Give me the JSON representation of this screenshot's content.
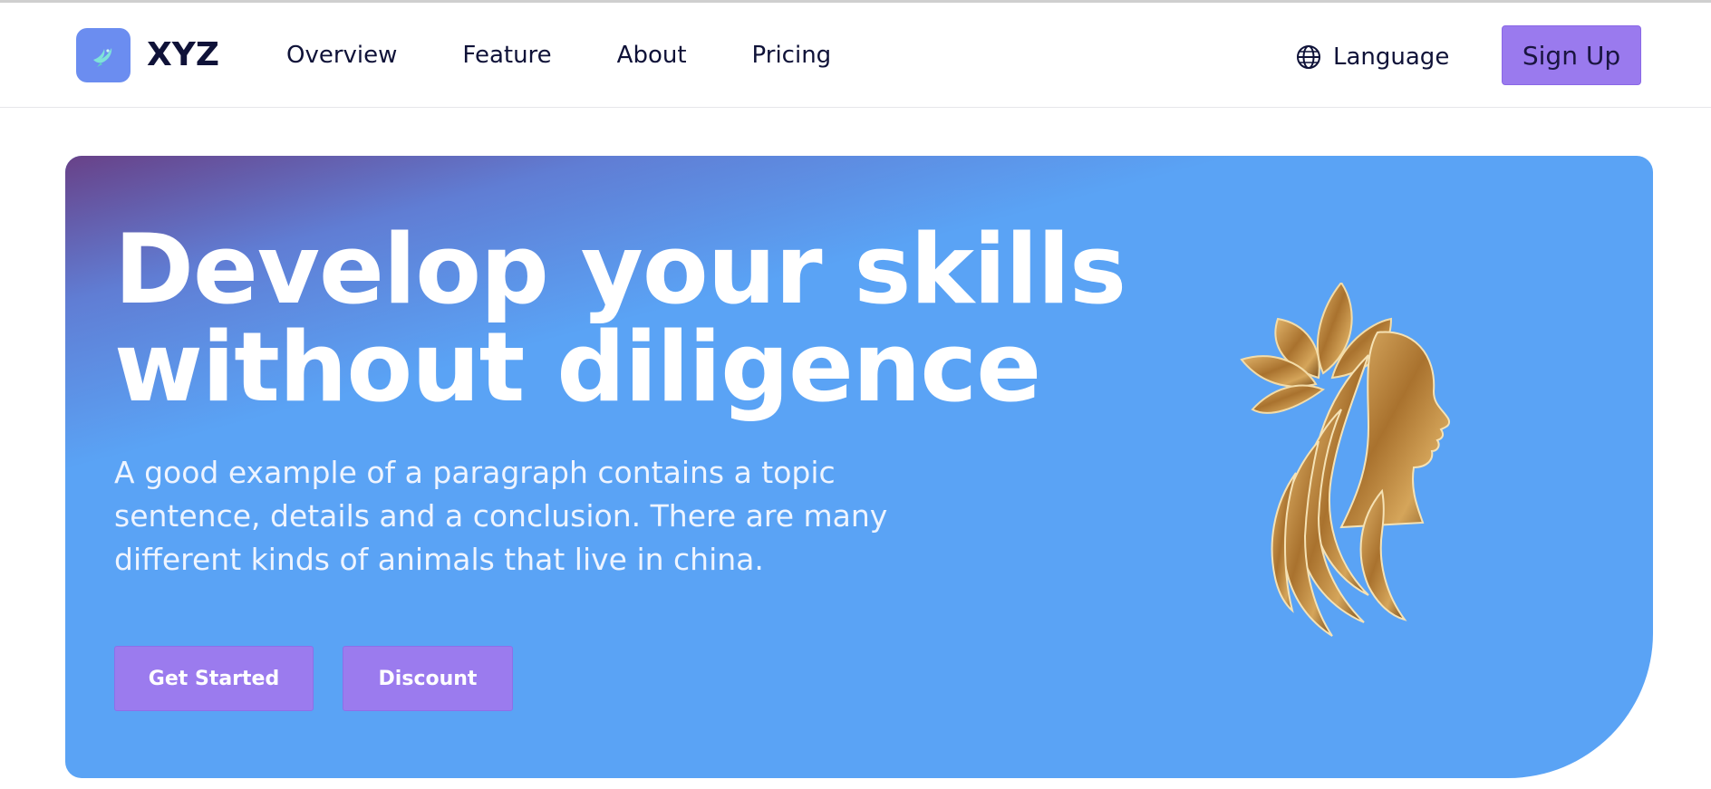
{
  "header": {
    "brand": "XYZ",
    "nav": [
      "Overview",
      "Feature",
      "About",
      "Pricing"
    ],
    "language_label": "Language",
    "signup_label": "Sign Up"
  },
  "hero": {
    "headline_line1": "Develop your skills",
    "headline_line2": "without diligence",
    "paragraph": "A good example of a paragraph contains a topic sentence, details and a conclusion. There are many different kinds of animals that live in china.",
    "primary_button": "Get Started",
    "secondary_button": "Discount"
  },
  "icons": {
    "logo": "bird-icon",
    "language": "globe-icon",
    "hero_image": "woman-lotus-silhouette-icon"
  },
  "colors": {
    "accent": "#9a7aee",
    "hero_bg": "#5aa3f5",
    "logo_tile": "#6b8df0",
    "text_dark": "#0f1238",
    "gold": "#b7843a"
  }
}
